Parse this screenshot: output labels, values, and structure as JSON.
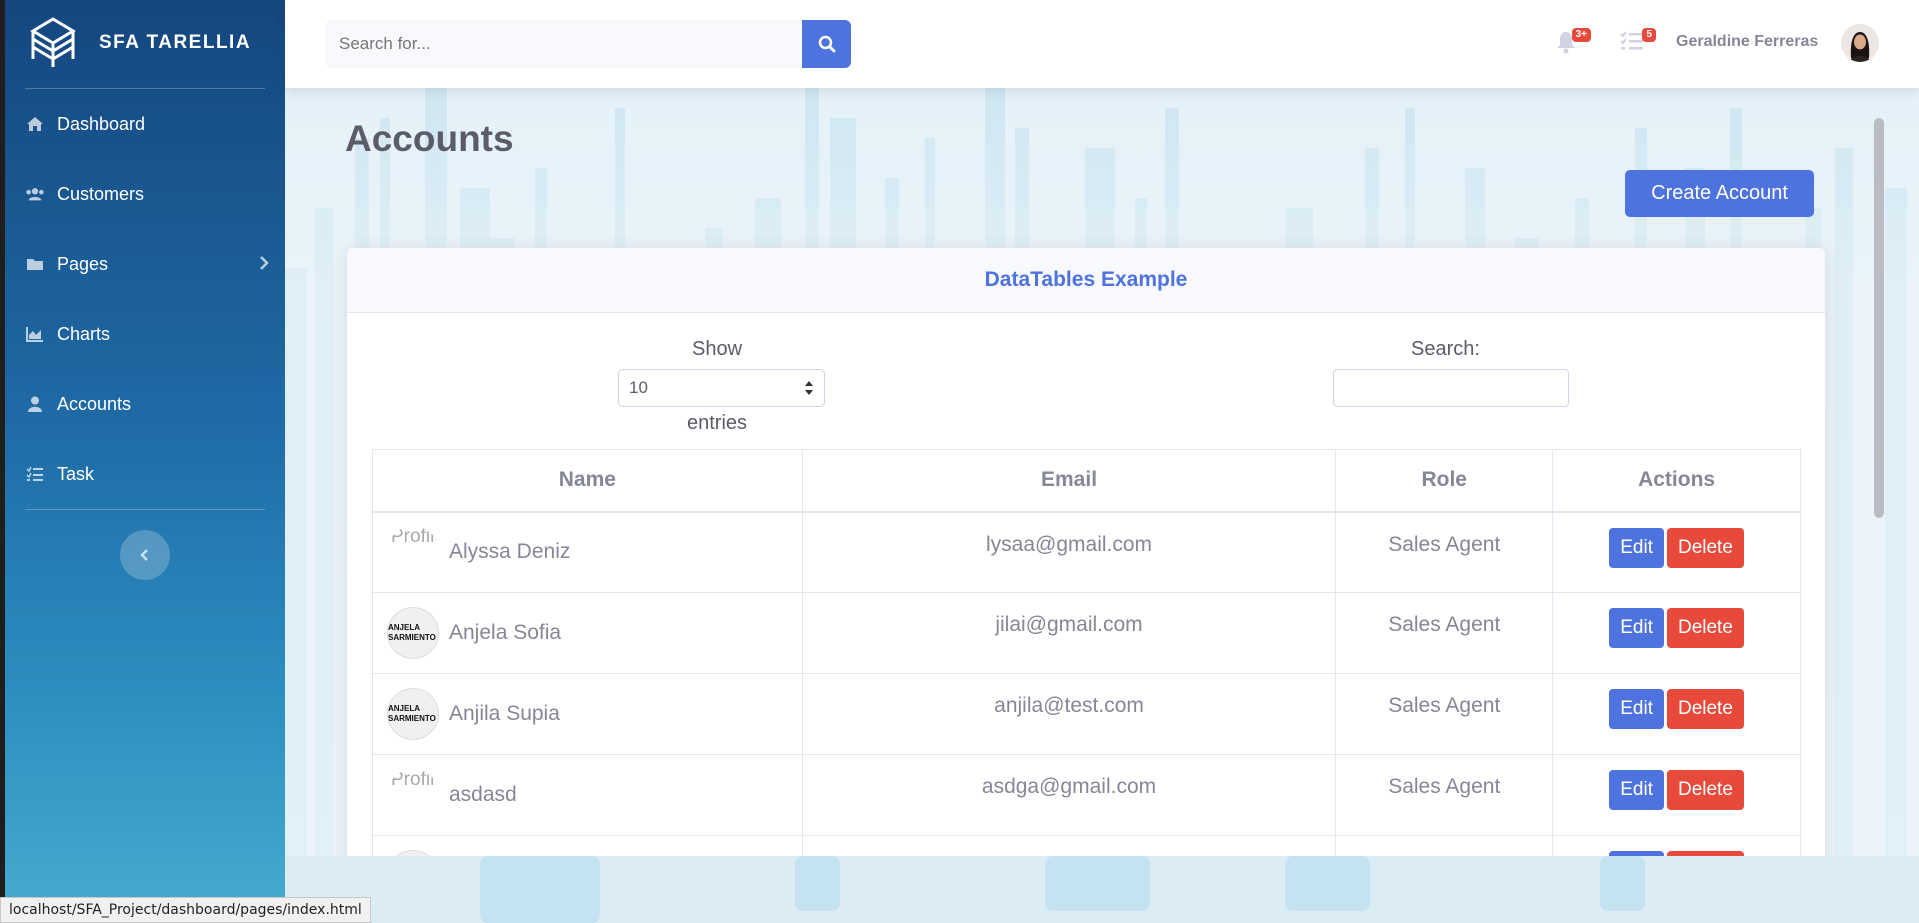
{
  "brand": {
    "name": "SFA TARELLIA",
    "logo_icon": "brand-logo-icon"
  },
  "sidebar": {
    "items": [
      {
        "label": "Dashboard",
        "icon": "home-icon"
      },
      {
        "label": "Customers",
        "icon": "users-icon"
      },
      {
        "label": "Pages",
        "icon": "folder-icon",
        "has_submenu": true
      },
      {
        "label": "Charts",
        "icon": "chart-area-icon"
      },
      {
        "label": "Accounts",
        "icon": "user-icon",
        "active": true
      },
      {
        "label": "Task",
        "icon": "tasks-icon"
      }
    ],
    "toggle_icon": "chevron-left-icon"
  },
  "topbar": {
    "search_placeholder": "Search for...",
    "alerts_badge": "3+",
    "tasks_badge": "5",
    "user_name": "Geraldine Ferreras"
  },
  "page": {
    "title": "Accounts",
    "create_button": "Create Account",
    "card_title": "DataTables Example",
    "show_label": "Show",
    "entries_value": "10",
    "entries_label": "entries",
    "search_label": "Search:"
  },
  "table": {
    "headers": [
      "Name",
      "Email",
      "Role",
      "Actions"
    ],
    "rows": [
      {
        "name": "Alyssa Deniz",
        "email": "lysaa@gmail.com",
        "role": "Sales Agent",
        "avatar": "broken",
        "broken_alt": "Profile"
      },
      {
        "name": "Anjela Sofia",
        "email": "jilai@gmail.com",
        "role": "Sales Agent",
        "avatar": "logo",
        "logo_text": "ANJELA SARMIENTO"
      },
      {
        "name": "Anjila Supia",
        "email": "anjila@test.com",
        "role": "Sales Agent",
        "avatar": "logo",
        "logo_text": "ANJELA SARMIENTO"
      },
      {
        "name": "asdasd",
        "email": "asdga@gmail.com",
        "role": "Sales Agent",
        "avatar": "broken",
        "broken_alt": "Profile"
      }
    ],
    "edit_label": "Edit",
    "delete_label": "Delete"
  },
  "status_bar": {
    "url": "localhost/SFA_Project/dashboard/pages/index.html"
  },
  "colors": {
    "primary": "#4e73df",
    "danger": "#e74a3b",
    "sidebar_top": "#15467f",
    "sidebar_bottom": "#47acd1"
  }
}
